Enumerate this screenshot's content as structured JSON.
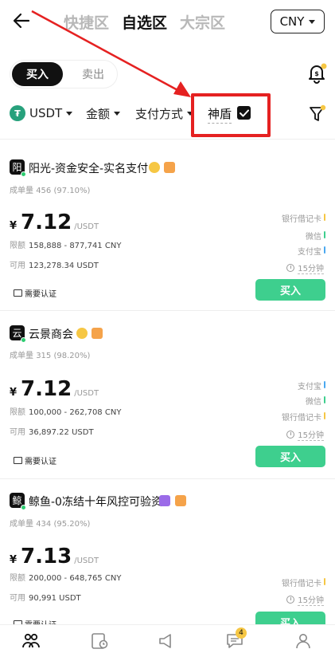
{
  "header": {
    "tabs": [
      {
        "label": "快捷区",
        "active": false
      },
      {
        "label": "自选区",
        "active": true
      },
      {
        "label": "大宗区",
        "active": false
      }
    ],
    "currency": "CNY"
  },
  "trade_toggle": {
    "buy": "买入",
    "sell": "卖出",
    "selected": "buy"
  },
  "filters": {
    "asset": "USDT",
    "asset_icon_text": "₮",
    "amount": "金额",
    "payment": "支付方式",
    "shield_label": "神盾",
    "shield_checked": true
  },
  "listings": [
    {
      "avatar": "阳",
      "name": "阳光-资金安全-实名支付",
      "badges": [
        "gold-medal-icon",
        "shield-badge-icon"
      ],
      "stats_label": "成单量",
      "stats": "456 (97.10%)",
      "currency_symbol": "¥",
      "price": "7.12",
      "unit": "/USDT",
      "limit_label": "限额",
      "limit": "158,888 - 877,741 CNY",
      "available_label": "可用",
      "available": "123,278.34 USDT",
      "payments": [
        {
          "name": "银行借记卡",
          "color": "#f6c744"
        },
        {
          "name": "微信",
          "color": "#3ecf8e"
        },
        {
          "name": "支付宝",
          "color": "#4aa8f0"
        }
      ],
      "time": "15分钟",
      "verify": "需要认证",
      "button": "买入"
    },
    {
      "avatar": "云",
      "name": "云景商会",
      "badges": [
        "gold-medal-icon",
        "shield-badge-icon"
      ],
      "stats_label": "成单量",
      "stats": "315 (98.20%)",
      "currency_symbol": "¥",
      "price": "7.12",
      "unit": "/USDT",
      "limit_label": "限额",
      "limit": "100,000 - 262,708 CNY",
      "available_label": "可用",
      "available": "36,897.22 USDT",
      "payments": [
        {
          "name": "支付宝",
          "color": "#4aa8f0"
        },
        {
          "name": "微信",
          "color": "#3ecf8e"
        },
        {
          "name": "银行借记卡",
          "color": "#f6c744"
        }
      ],
      "time": "15分钟",
      "verify": "需要认证",
      "button": "买入"
    },
    {
      "avatar": "鲸",
      "name": "鲸鱼-0冻结十年风控可验资",
      "badges": [
        "diamond-icon",
        "shield-badge-icon"
      ],
      "stats_label": "成单量",
      "stats": "434 (95.20%)",
      "currency_symbol": "¥",
      "price": "7.13",
      "unit": "/USDT",
      "limit_label": "限额",
      "limit": "200,000 - 648,765 CNY",
      "available_label": "可用",
      "available": "90,991 USDT",
      "payments": [
        {
          "name": "银行借记卡",
          "color": "#f6c744"
        }
      ],
      "time": "15分钟",
      "verify": "需要认证",
      "button": "买入"
    }
  ],
  "bottom_nav": {
    "items": [
      "p2p-icon",
      "orders-icon",
      "ads-icon",
      "chat-icon",
      "profile-icon"
    ],
    "chat_badge": "4"
  },
  "colors": {
    "accent_green": "#3ecf8e",
    "highlight_red": "#e52121",
    "usdt_green": "#27a17c"
  }
}
